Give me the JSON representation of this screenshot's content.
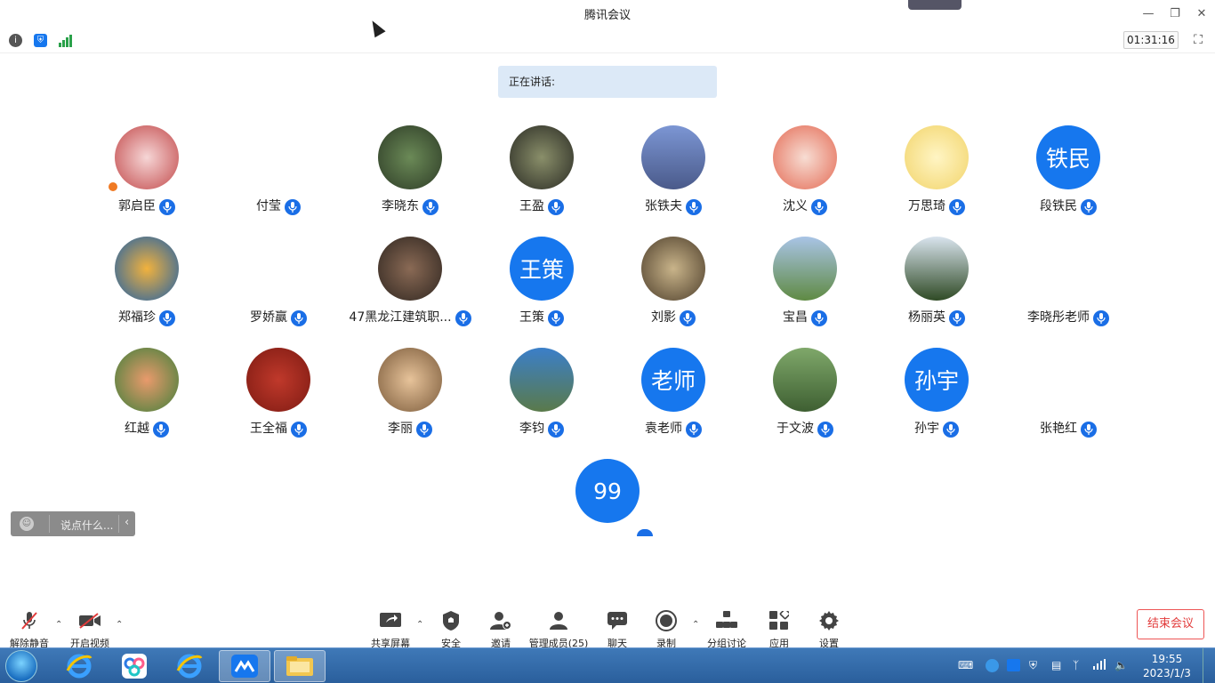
{
  "window": {
    "title": "腾讯会议"
  },
  "infobar": {
    "timer": "01:31:16"
  },
  "speaking": {
    "label": "正在讲话:"
  },
  "participants": [
    {
      "name": "郭启臣"
    },
    {
      "name": "付莹"
    },
    {
      "name": "李晓东"
    },
    {
      "name": "王盈"
    },
    {
      "name": "张铁夫"
    },
    {
      "name": "沈义"
    },
    {
      "name": "万思琦"
    },
    {
      "name": "段铁民",
      "avatar_text": "铁民"
    },
    {
      "name": "郑福珍"
    },
    {
      "name": "罗娇赢"
    },
    {
      "name": "47黑龙江建筑职..."
    },
    {
      "name": "王策",
      "avatar_text": "王策"
    },
    {
      "name": "刘影"
    },
    {
      "name": "宝昌"
    },
    {
      "name": "杨丽英"
    },
    {
      "name": "李晓彤老师"
    },
    {
      "name": "红越"
    },
    {
      "name": "王全福"
    },
    {
      "name": "李丽"
    },
    {
      "name": "李钧"
    },
    {
      "name": "袁老师",
      "avatar_text": "老师"
    },
    {
      "name": "于文波"
    },
    {
      "name": "孙宇",
      "avatar_text": "孙宇"
    },
    {
      "name": "张艳红"
    }
  ],
  "extra_tile": {
    "avatar_text": "99"
  },
  "chat": {
    "placeholder": "说点什么..."
  },
  "toolbar": {
    "unmute": "解除静音",
    "start_video": "开启视频",
    "share": "共享屏幕",
    "security": "安全",
    "invite": "邀请",
    "manage": "管理成员(25)",
    "chat": "聊天",
    "record": "录制",
    "breakout": "分组讨论",
    "apps": "应用",
    "settings": "设置",
    "end": "结束会议"
  },
  "taskbar": {
    "time": "19:55",
    "date": "2023/1/3"
  },
  "colors": {
    "accent": "#1677ee",
    "end": "#e23b3b",
    "speaking_bg": "#dce9f7"
  }
}
